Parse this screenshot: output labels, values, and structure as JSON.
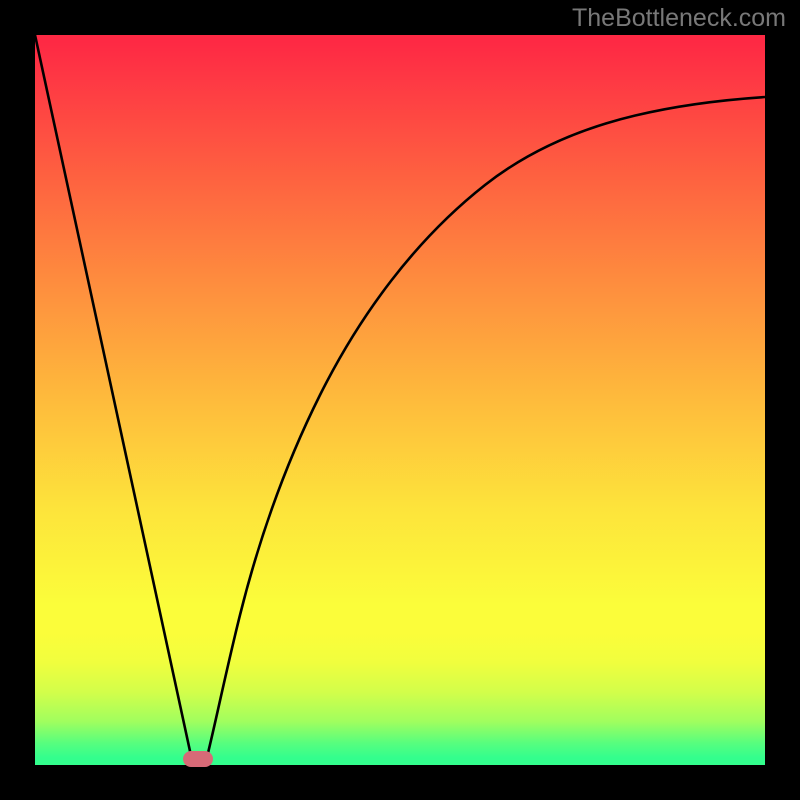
{
  "watermark": "TheBottleneck.com",
  "chart_data": {
    "type": "line",
    "title": "",
    "xlabel": "",
    "ylabel": "",
    "xlim": [
      0,
      100
    ],
    "ylim": [
      0,
      100
    ],
    "grid": false,
    "series": [
      {
        "name": "left-line",
        "x": [
          0,
          22
        ],
        "values": [
          100,
          0
        ]
      },
      {
        "name": "right-curve",
        "x": [
          23,
          25,
          28,
          32,
          38,
          45,
          55,
          68,
          82,
          100
        ],
        "values": [
          0,
          7,
          18,
          32,
          48,
          61,
          72,
          81,
          87,
          91
        ]
      }
    ],
    "marker": {
      "x": 22.5,
      "y": 0,
      "color": "#d76a77"
    },
    "gradient_stops": [
      {
        "pos": 0.0,
        "color": "#fe2944"
      },
      {
        "pos": 0.2,
        "color": "#fe6340"
      },
      {
        "pos": 0.35,
        "color": "#fe903e"
      },
      {
        "pos": 0.5,
        "color": "#febb3c"
      },
      {
        "pos": 0.65,
        "color": "#fde43b"
      },
      {
        "pos": 0.8,
        "color": "#fbfd3a"
      },
      {
        "pos": 0.9,
        "color": "#d3fe4a"
      },
      {
        "pos": 0.97,
        "color": "#57fe7e"
      },
      {
        "pos": 1.0,
        "color": "#33fe8d"
      }
    ]
  }
}
